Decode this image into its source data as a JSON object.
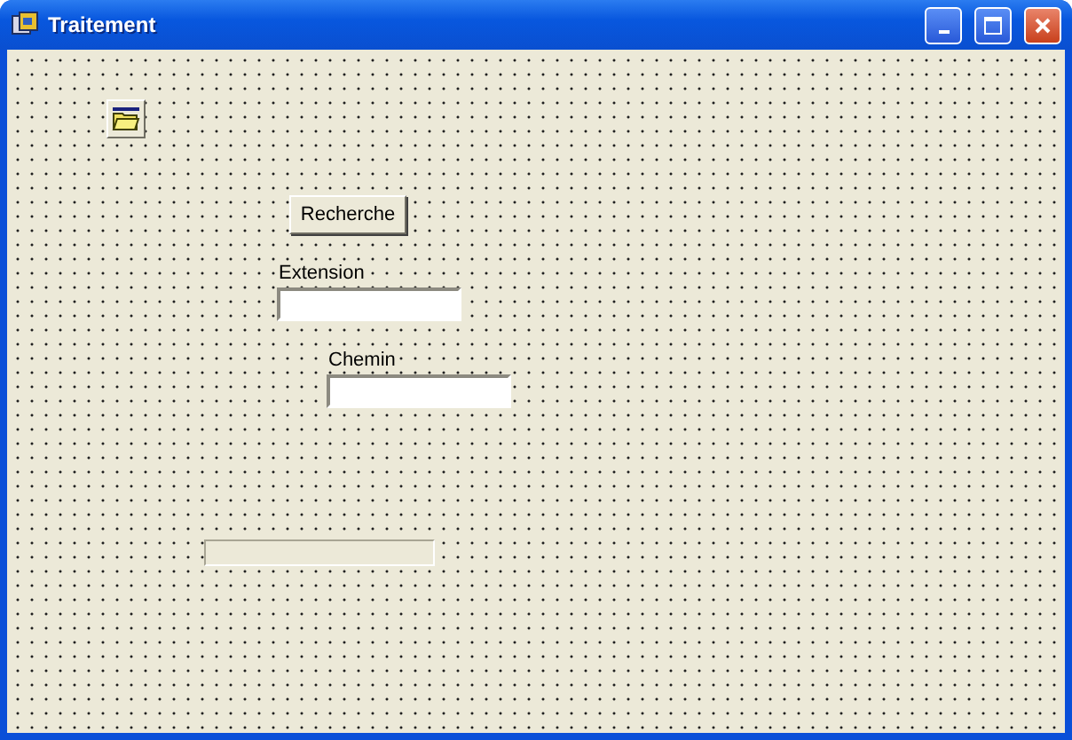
{
  "window": {
    "title": "Traitement"
  },
  "form": {
    "button": "Recherche",
    "fields": [
      {
        "label": "Extension"
      },
      {
        "label": "Chemin"
      }
    ],
    "progress": {
      "level": 0
    }
  }
}
